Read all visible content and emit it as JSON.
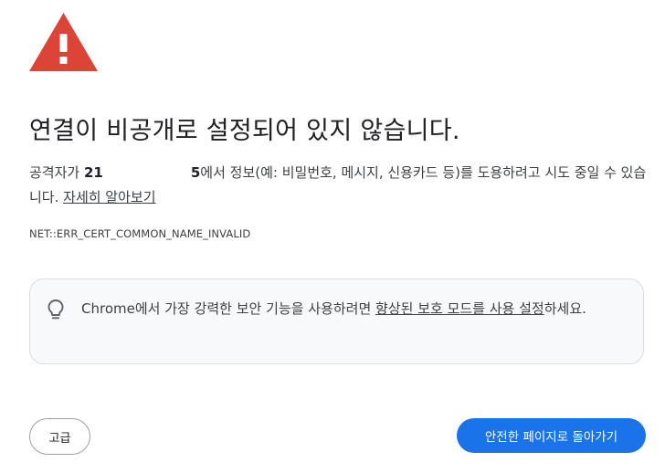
{
  "warning": {
    "icon": "warning-triangle-icon",
    "color": "#db4437"
  },
  "title": "연결이 비공개로 설정되어 있지 않습니다.",
  "description": {
    "prefix": "공격자가 ",
    "host_start": "21",
    "host_end": "5",
    "suffix": "에서 정보(예: 비밀번호, 메시지, 신용카드 등)를 도용하려고 시도 중일 수 있습니다. ",
    "learn_more": "자세히 알아보기"
  },
  "error_code": "NET::ERR_CERT_COMMON_NAME_INVALID",
  "protection_card": {
    "icon": "lightbulb-icon",
    "text_before": "Chrome에서 가장 강력한 보안 기능을 사용하려면 ",
    "link": "향상된 보호 모드를 사용 설정",
    "text_after": "하세요."
  },
  "buttons": {
    "advanced": "고급",
    "back_to_safety": "안전한 페이지로 돌아가기"
  },
  "colors": {
    "primary": "#1a73e8",
    "card_background": "#f8f9fa"
  }
}
